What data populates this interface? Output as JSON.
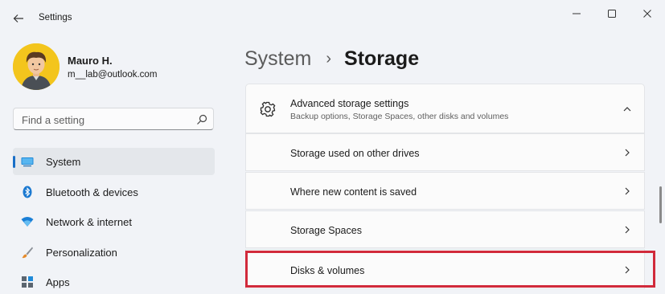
{
  "window": {
    "title": "Settings"
  },
  "user": {
    "name": "Mauro H.",
    "email": "m__lab@outlook.com"
  },
  "search": {
    "placeholder": "Find a setting"
  },
  "sidebar": {
    "items": [
      {
        "label": "System",
        "icon": "system-icon",
        "active": true
      },
      {
        "label": "Bluetooth & devices",
        "icon": "bluetooth-icon"
      },
      {
        "label": "Network & internet",
        "icon": "wifi-icon"
      },
      {
        "label": "Personalization",
        "icon": "brush-icon"
      },
      {
        "label": "Apps",
        "icon": "apps-icon"
      }
    ]
  },
  "breadcrumb": {
    "parent": "System",
    "separator": "›",
    "current": "Storage"
  },
  "advanced": {
    "title": "Advanced storage settings",
    "subtitle": "Backup options, Storage Spaces, other disks and volumes",
    "rows": [
      "Storage used on other drives",
      "Where new content is saved",
      "Storage Spaces",
      "Disks & volumes"
    ]
  },
  "colors": {
    "accent": "#1a6fc7",
    "highlight": "#d12a3b",
    "avatar_bg": "#f3c51d"
  }
}
